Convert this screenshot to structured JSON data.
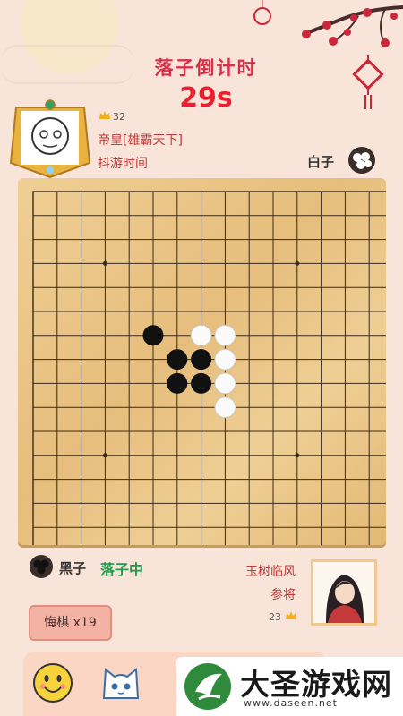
{
  "header": {
    "countdown_title": "落子倒计时",
    "countdown_value": "29s"
  },
  "player_top": {
    "crown_count": "32",
    "name": "帝皇[雄霸天下]",
    "subtitle": "抖游时间",
    "stone_label": "白子"
  },
  "player_bottom": {
    "stone_label": "黑子",
    "status": "落子中",
    "name": "玉树临风",
    "rank": "参将",
    "crown_count": "23"
  },
  "controls": {
    "undo_label": "悔棋 x19"
  },
  "board": {
    "size": 15,
    "star_points": [
      [
        3,
        3
      ],
      [
        11,
        3
      ],
      [
        3,
        11
      ],
      [
        11,
        11
      ]
    ],
    "black_stones": [
      [
        5,
        6
      ],
      [
        6,
        7
      ],
      [
        7,
        7
      ],
      [
        6,
        8
      ],
      [
        7,
        8
      ]
    ],
    "white_stones": [
      [
        7,
        6
      ],
      [
        8,
        6
      ],
      [
        8,
        7
      ],
      [
        8,
        8
      ],
      [
        8,
        9
      ]
    ]
  },
  "emojis": [
    "smiley-face",
    "cat-face"
  ],
  "watermark": {
    "title": "大圣游戏网",
    "url": "www.daseen.net"
  },
  "colors": {
    "accent_red": "#d9304a",
    "status_green": "#1d9a4a",
    "board_wood": "#e6bd7c"
  }
}
